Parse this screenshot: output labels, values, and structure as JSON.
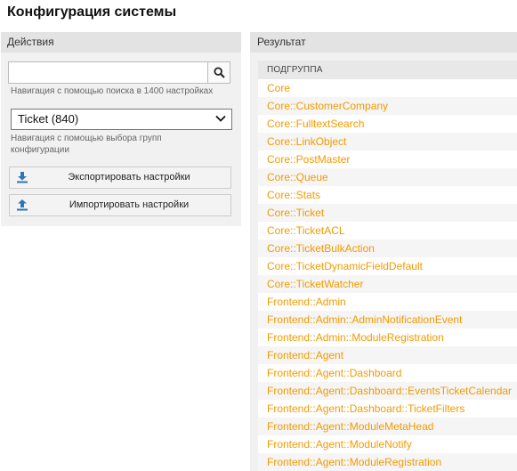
{
  "page": {
    "title": "Конфигурация системы"
  },
  "actions": {
    "header": "Действия",
    "search": {
      "value": "",
      "placeholder": "",
      "hint": "Навигация с помощью поиска в 1400 настройках"
    },
    "group_select": {
      "selected": "Ticket (840)",
      "hint": "Навигация с помощью выбора групп конфигурации"
    },
    "export_label": "Экспортировать настройки",
    "import_label": "Импортировать настройки"
  },
  "result": {
    "header": "Результат",
    "column_header": "ПОДГРУППА",
    "rows": [
      "Core",
      "Core::CustomerCompany",
      "Core::FulltextSearch",
      "Core::LinkObject",
      "Core::PostMaster",
      "Core::Queue",
      "Core::Stats",
      "Core::Ticket",
      "Core::TicketACL",
      "Core::TicketBulkAction",
      "Core::TicketDynamicFieldDefault",
      "Core::TicketWatcher",
      "Frontend::Admin",
      "Frontend::Admin::AdminNotificationEvent",
      "Frontend::Admin::ModuleRegistration",
      "Frontend::Agent",
      "Frontend::Agent::Dashboard",
      "Frontend::Agent::Dashboard::EventsTicketCalendar",
      "Frontend::Agent::Dashboard::TicketFilters",
      "Frontend::Agent::ModuleMetaHead",
      "Frontend::Agent::ModuleNotify",
      "Frontend::Agent::ModuleRegistration"
    ]
  },
  "colors": {
    "link": "#f29a00",
    "panel": "#f1f1f1",
    "header": "#e3e3e3",
    "icon_blue": "#2f74b5"
  },
  "icons": {
    "search": "search-icon",
    "export": "download-icon",
    "import": "upload-icon",
    "select": "chevron-down-icon"
  }
}
